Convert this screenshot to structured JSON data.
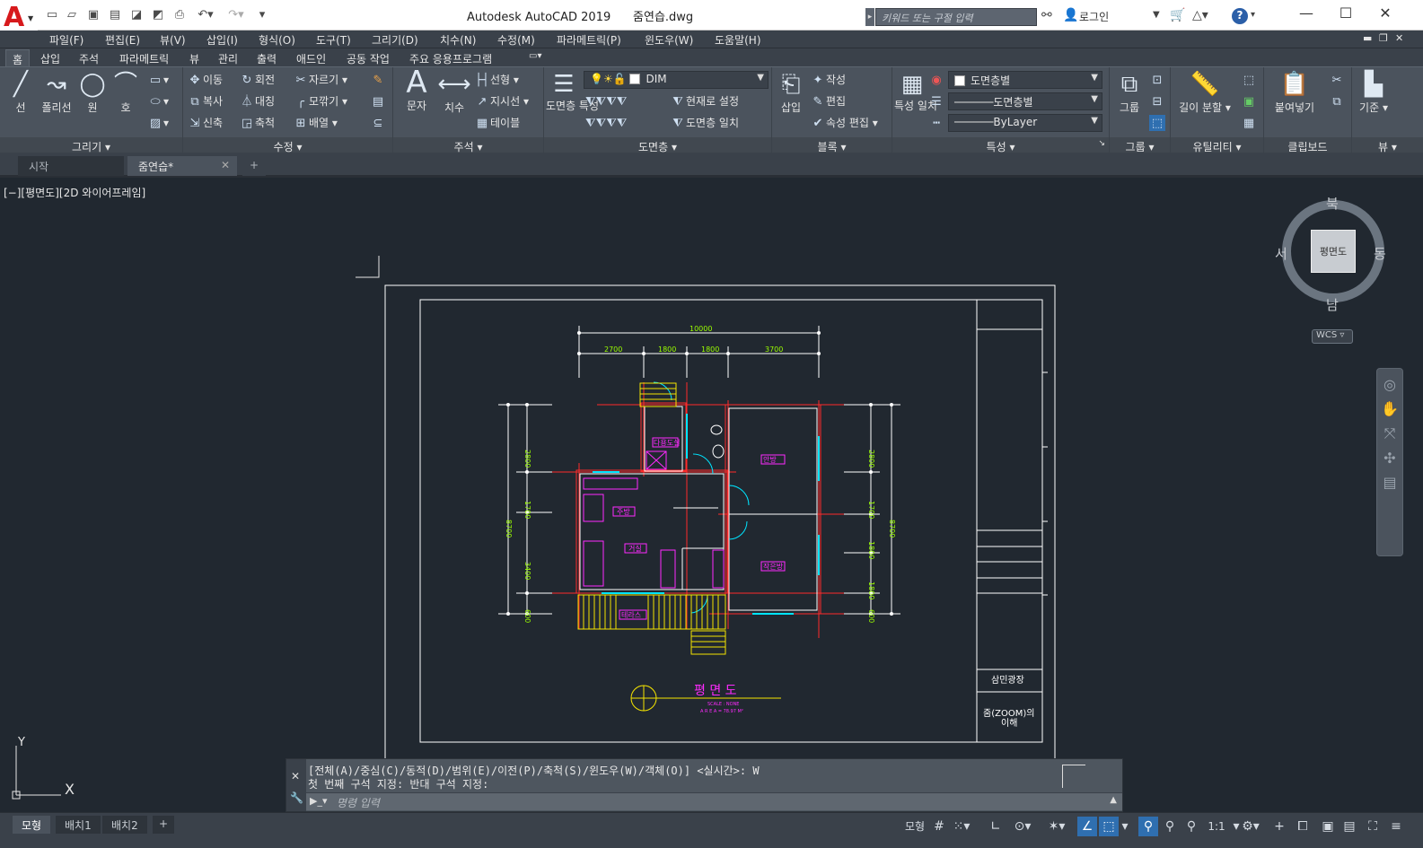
{
  "app": {
    "logo_letter": "A",
    "title": "Autodesk AutoCAD 2019      줌연습.dwg",
    "search_placeholder": "키워드 또는 구절 입력",
    "login": "로그인"
  },
  "menus": [
    "파일(F)",
    "편집(E)",
    "뷰(V)",
    "삽입(I)",
    "형식(O)",
    "도구(T)",
    "그리기(D)",
    "치수(N)",
    "수정(M)",
    "파라메트릭(P)",
    "윈도우(W)",
    "도움말(H)"
  ],
  "ribbon_tabs": [
    "홈",
    "삽입",
    "주석",
    "파라메트릭",
    "뷰",
    "관리",
    "출력",
    "애드인",
    "공동 작업",
    "주요 응용프로그램"
  ],
  "panels": {
    "draw": {
      "title": "그리기",
      "line": "선",
      "polyline": "폴리선",
      "circle": "원",
      "arc": "호"
    },
    "modify": {
      "title": "수정",
      "move": "이동",
      "rotate": "회전",
      "trim": "자르기",
      "copy": "복사",
      "mirror": "대칭",
      "fillet": "모깎기",
      "stretch": "신축",
      "scale": "축척",
      "array": "배열"
    },
    "annotation": {
      "title": "주석",
      "text": "문자",
      "dimension": "치수",
      "linear": "선형",
      "leader": "지시선",
      "table": "테이블"
    },
    "layers": {
      "title": "도면층",
      "props": "도면층 특성",
      "current_layer": "DIM",
      "set_current": "현재로 설정",
      "match": "도면층 일치"
    },
    "block": {
      "title": "블록",
      "insert": "삽입",
      "create": "작성",
      "edit": "편집",
      "attr_edit": "속성 편집"
    },
    "properties": {
      "title": "특성",
      "match": "특성 일치",
      "color": "도면층별",
      "linetype": "도면층별",
      "lineweight": "ByLayer"
    },
    "groups": {
      "title": "그룹",
      "group": "그룹"
    },
    "utilities": {
      "title": "유틸리티",
      "measure": "길이 분할"
    },
    "clipboard": {
      "title": "클립보드",
      "paste": "붙여넣기"
    },
    "view": {
      "title": "뷰",
      "base": "기준"
    }
  },
  "file_tabs": [
    "시작",
    "줌연습*"
  ],
  "viewport": {
    "label": "[−][평면도][2D 와이어프레임]"
  },
  "viewcube": {
    "north": "북",
    "south": "남",
    "east": "동",
    "west": "서",
    "face": "평면도",
    "wcs": "WCS"
  },
  "ucs": {
    "x": "X",
    "y": "Y"
  },
  "drawing": {
    "dims_top": [
      "10000",
      "2700",
      "1800",
      "1800",
      "3700"
    ],
    "dims_left": [
      "2800",
      "1700",
      "3400",
      "600",
      "8700"
    ],
    "dims_right": [
      "2800",
      "1700",
      "1800",
      "1800",
      "600",
      "8700"
    ],
    "rooms": [
      "다용도실",
      "욕실",
      "주방",
      "안방",
      "거실",
      "작은방",
      "테라스"
    ],
    "title": "평 면 도",
    "scale": "SCALE : NONE",
    "area": "A R E A = 78.97 M²",
    "titleblock_1": "삼민광장",
    "titleblock_2": "줌(ZOOM)의",
    "titleblock_3": "이해"
  },
  "command": {
    "history1": "[전체(A)/중심(C)/동적(D)/범위(E)/이전(P)/축척(S)/윈도우(W)/객체(O)] <실시간>: W",
    "history2": "첫 번째 구석 지정: 반대 구석 지정:",
    "placeholder": "명령 입력"
  },
  "layout_tabs": [
    "모형",
    "배치1",
    "배치2"
  ],
  "status": {
    "model": "모형",
    "scale": "1:1"
  }
}
